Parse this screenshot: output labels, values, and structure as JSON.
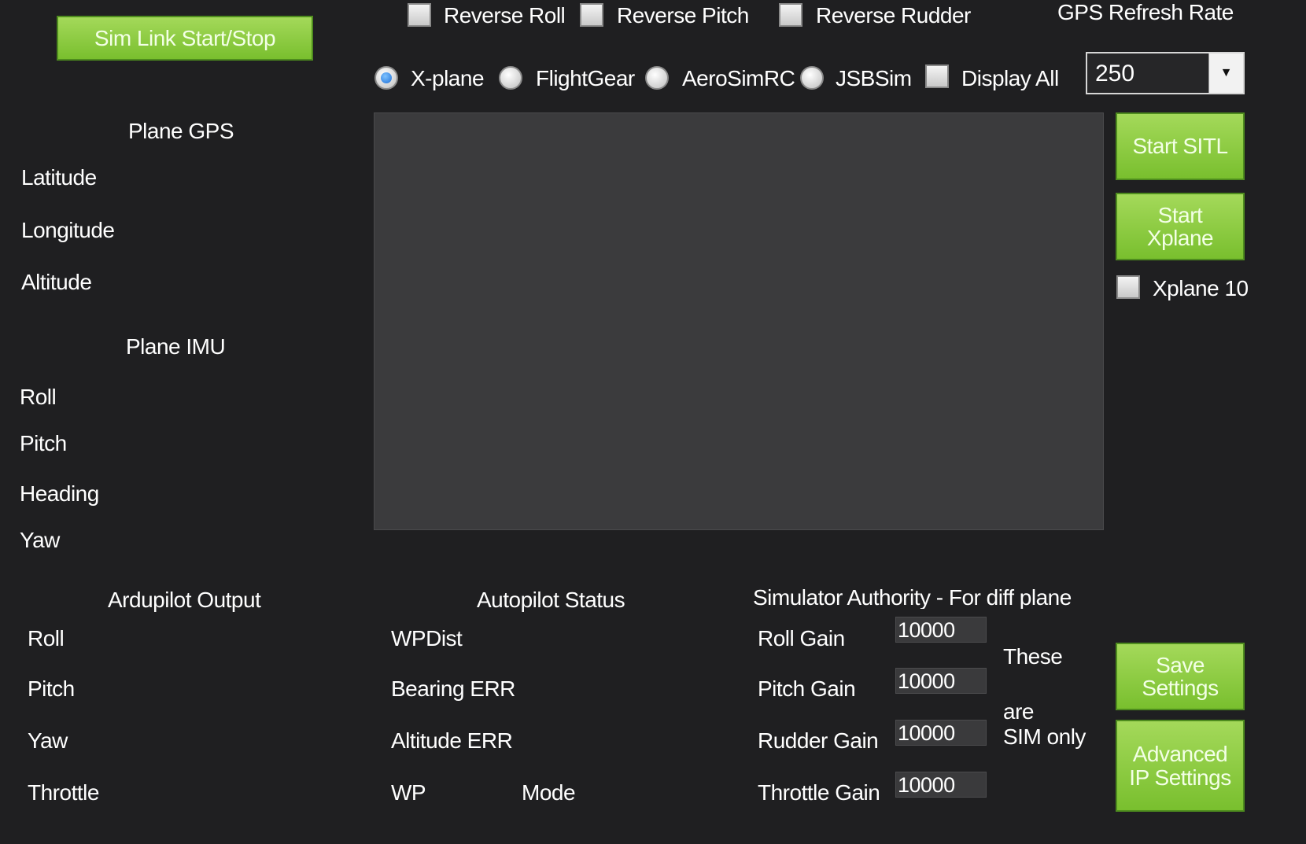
{
  "top": {
    "sim_link_button": "Sim Link Start/Stop",
    "reverse_roll": "Reverse Roll",
    "reverse_pitch": "Reverse Pitch",
    "reverse_rudder": "Reverse Rudder",
    "gps_refresh_label": "GPS Refresh Rate",
    "gps_refresh_value": "250"
  },
  "simulators": {
    "xplane": "X-plane",
    "flightgear": "FlightGear",
    "aerosimrc": "AeroSimRC",
    "jsbsim": "JSBSim",
    "display_all": "Display All",
    "selected": "X-plane"
  },
  "plane_gps": {
    "title": "Plane GPS",
    "latitude": "Latitude",
    "longitude": "Longitude",
    "altitude": "Altitude"
  },
  "plane_imu": {
    "title": "Plane IMU",
    "roll": "Roll",
    "pitch": "Pitch",
    "heading": "Heading",
    "yaw": "Yaw"
  },
  "right_panel": {
    "start_sitl": "Start SITL",
    "start_xplane_line1": "Start",
    "start_xplane_line2": "Xplane",
    "xplane10": "Xplane 10",
    "save_line1": "Save",
    "save_line2": "Settings",
    "advanced_line1": "Advanced",
    "advanced_line2": "IP Settings"
  },
  "ardupilot_output": {
    "title": "Ardupilot Output",
    "roll": "Roll",
    "pitch": "Pitch",
    "yaw": "Yaw",
    "throttle": "Throttle"
  },
  "autopilot_status": {
    "title": "Autopilot Status",
    "wpdist": "WPDist",
    "bearing_err": "Bearing ERR",
    "altitude_err": "Altitude ERR",
    "wp": "WP",
    "mode": "Mode"
  },
  "sim_authority": {
    "title": "Simulator Authority - For diff plane",
    "roll_gain_label": "Roll Gain",
    "roll_gain_value": "10000",
    "pitch_gain_label": "Pitch Gain",
    "pitch_gain_value": "10000",
    "rudder_gain_label": "Rudder Gain",
    "rudder_gain_value": "10000",
    "throttle_gain_label": "Throttle Gain",
    "throttle_gain_value": "10000",
    "note_line1": "These",
    "note_line2": "are",
    "note_line3": "SIM only"
  },
  "colors": {
    "background": "#1f1f21",
    "button_green": "#8ccc44",
    "console": "#3b3b3d"
  }
}
